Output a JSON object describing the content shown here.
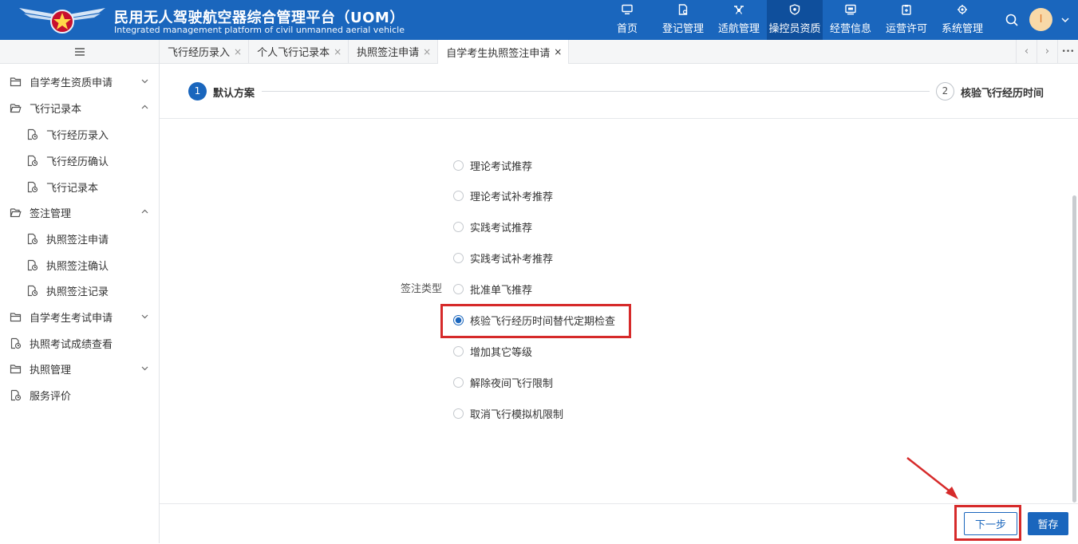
{
  "header": {
    "title_cn": "民用无人驾驶航空器综合管理平台（UOM）",
    "title_en": "Integrated management platform of civil unmanned aerial vehicle",
    "nav": [
      {
        "label": "首页",
        "icon": "monitor-icon"
      },
      {
        "label": "登记管理",
        "icon": "document-icon"
      },
      {
        "label": "适航管理",
        "icon": "drone-icon"
      },
      {
        "label": "操控员资质",
        "icon": "shield-icon",
        "active": true
      },
      {
        "label": "经营信息",
        "icon": "screen-icon"
      },
      {
        "label": "运营许可",
        "icon": "clipboard-icon"
      },
      {
        "label": "系统管理",
        "icon": "settings-icon"
      }
    ],
    "avatar_initial": "I",
    "brand_color": "#1a66bd"
  },
  "tabs": [
    {
      "label": "飞行经历录入",
      "close": "×"
    },
    {
      "label": "个人飞行记录本",
      "close": "×"
    },
    {
      "label": "执照签注申请",
      "close": "×"
    },
    {
      "label": "自学考生执照签注申请",
      "close": "×",
      "active": true
    }
  ],
  "tab_controls": {
    "prev": "‹",
    "next": "›",
    "more": "•••"
  },
  "sidebar": {
    "items": [
      {
        "label": "自学考生资质申请",
        "icon": "folder-icon",
        "chevron": "down"
      },
      {
        "label": "飞行记录本",
        "icon": "folder-open-icon",
        "chevron": "up"
      },
      {
        "label": "飞行经历录入",
        "icon": "file-icon",
        "sub": true
      },
      {
        "label": "飞行经历确认",
        "icon": "file-icon",
        "sub": true
      },
      {
        "label": "飞行记录本",
        "icon": "file-icon",
        "sub": true
      },
      {
        "label": "签注管理",
        "icon": "folder-open-icon",
        "chevron": "up"
      },
      {
        "label": "执照签注申请",
        "icon": "file-icon",
        "sub": true
      },
      {
        "label": "执照签注确认",
        "icon": "file-icon",
        "sub": true
      },
      {
        "label": "执照签注记录",
        "icon": "file-icon",
        "sub": true
      },
      {
        "label": "自学考生考试申请",
        "icon": "folder-icon",
        "chevron": "down"
      },
      {
        "label": "执照考试成绩查看",
        "icon": "file-icon"
      },
      {
        "label": "执照管理",
        "icon": "folder-icon",
        "chevron": "down"
      },
      {
        "label": "服务评价",
        "icon": "file-icon"
      }
    ]
  },
  "steps": [
    {
      "number": "1",
      "label": "默认方案",
      "state": "active"
    },
    {
      "number": "2",
      "label": "核验飞行经历时间",
      "state": "pending"
    }
  ],
  "form": {
    "field_label": "签注类型",
    "options": [
      {
        "label": "理论考试推荐",
        "checked": false
      },
      {
        "label": "理论考试补考推荐",
        "checked": false
      },
      {
        "label": "实践考试推荐",
        "checked": false
      },
      {
        "label": "实践考试补考推荐",
        "checked": false
      },
      {
        "label": "批准单飞推荐",
        "checked": false
      },
      {
        "label": "核验飞行经历时间替代定期检查",
        "checked": true
      },
      {
        "label": "增加其它等级",
        "checked": false
      },
      {
        "label": "解除夜间飞行限制",
        "checked": false
      },
      {
        "label": "取消飞行模拟机限制",
        "checked": false
      }
    ]
  },
  "footer": {
    "next_label": "下一步",
    "save_label": "暂存"
  },
  "annotation_color": "#d62a2a"
}
